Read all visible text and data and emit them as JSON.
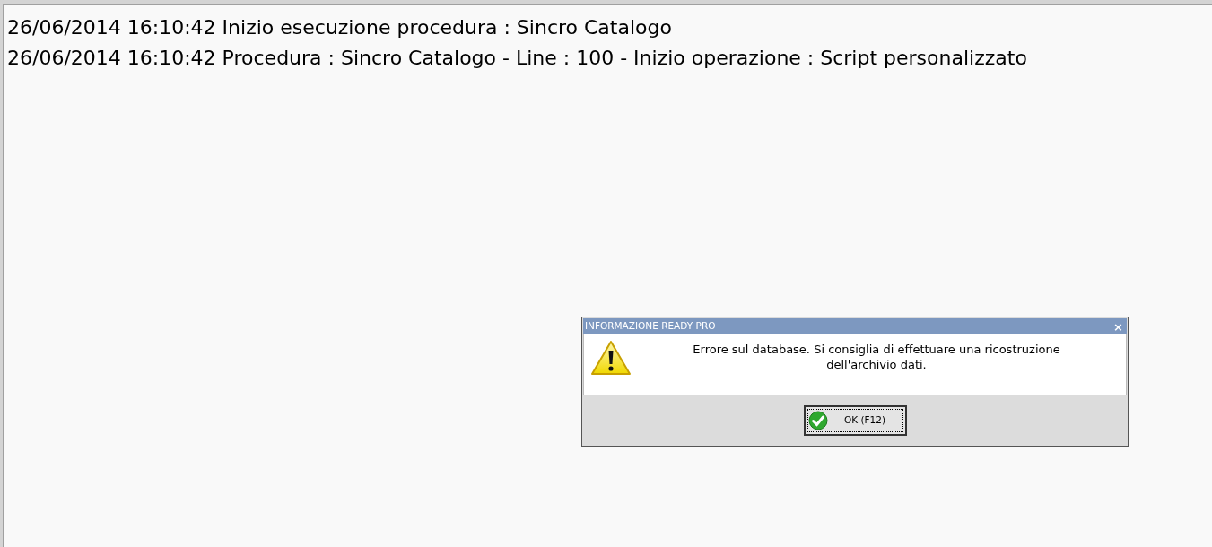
{
  "log_lines": [
    "26/06/2014 16:10:42 Inizio esecuzione procedura : Sincro Catalogo",
    "26/06/2014 16:10:42 Procedura : Sincro Catalogo - Line : 100 - Inizio operazione : Script personalizzato"
  ],
  "dialog": {
    "title": "INFORMAZIONE READY PRO",
    "close": "×",
    "message": "Errore sul database. Si consiglia di effettuare una ricostruzione dell'archivio dati.",
    "button": "OK (F12)"
  }
}
